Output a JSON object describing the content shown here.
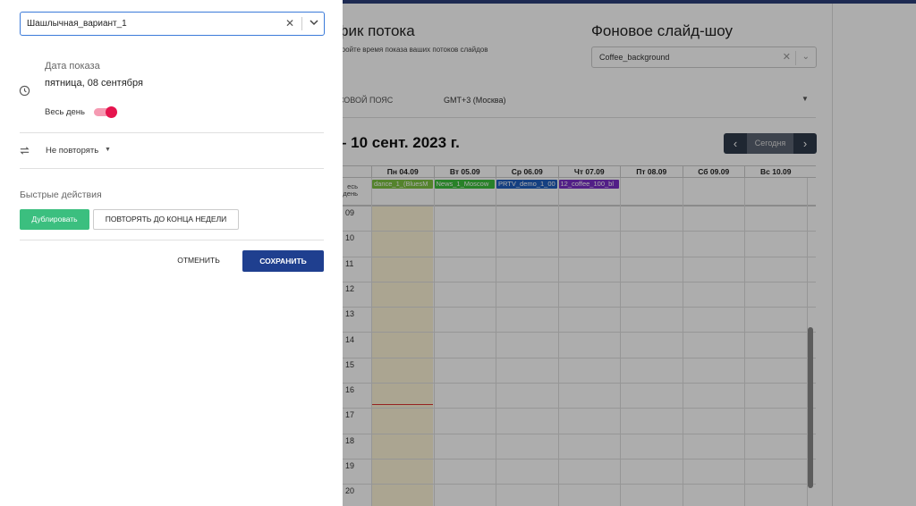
{
  "schedule": {
    "title": "афик потока",
    "subtitle": "стройте время показа ваших потоков слайдов"
  },
  "background_slideshow": {
    "title": "Фоновое слайд-шоу",
    "value": "Coffee_background"
  },
  "timezone": {
    "label": "СОВОЙ ПОЯС",
    "value": "GMT+3 (Москва)"
  },
  "calendar": {
    "range_title": "– 10 сент. 2023 г.",
    "nav": {
      "prev": "‹",
      "today": "Сегодня",
      "next": "›"
    },
    "days": [
      "Пн 04.09",
      "Вт 05.09",
      "Ср 06.09",
      "Чт 07.09",
      "Пт 08.09",
      "Сб 09.09",
      "Вс 10.09"
    ],
    "allday_label": "есь день",
    "allday_events": [
      {
        "day": 0,
        "title": "dance_1_(BluesM",
        "color": "#7cc242"
      },
      {
        "day": 1,
        "title": "News_1_Moscow",
        "color": "#3bbf3b"
      },
      {
        "day": 2,
        "title": "PRTV_demo_1_00",
        "color": "#1f5fbf"
      },
      {
        "day": 3,
        "title": "12_coffee_100_bl",
        "color": "#7a2fc7"
      }
    ],
    "hours": [
      "09",
      "10",
      "11",
      "12",
      "13",
      "14",
      "15",
      "16",
      "17",
      "18",
      "19",
      "20"
    ]
  },
  "panel": {
    "stream_select_value": "Шашлычная_вариант_1",
    "date_label": "Дата показа",
    "date_value": "пятница, 08 сентября",
    "allday_text": "Весь день",
    "allday_on": true,
    "repeat_text": "Не повторять",
    "quick_actions_label": "Быстрые действия",
    "duplicate_label": "Дублировать",
    "repeat_week_label": "ПОВТОРЯТЬ ДО КОНЦА НЕДЕЛИ",
    "cancel_label": "ОТМЕНИТЬ",
    "save_label": "СОХРАНИТЬ"
  },
  "colors": {
    "accent": "#1f3f8f",
    "success": "#3bbf7f",
    "toggle": "#e6144e"
  },
  "icons": {
    "clock": "clock-icon",
    "repeat": "repeat-icon",
    "clear": "close-icon",
    "dropdown": "chevron-down-icon"
  }
}
